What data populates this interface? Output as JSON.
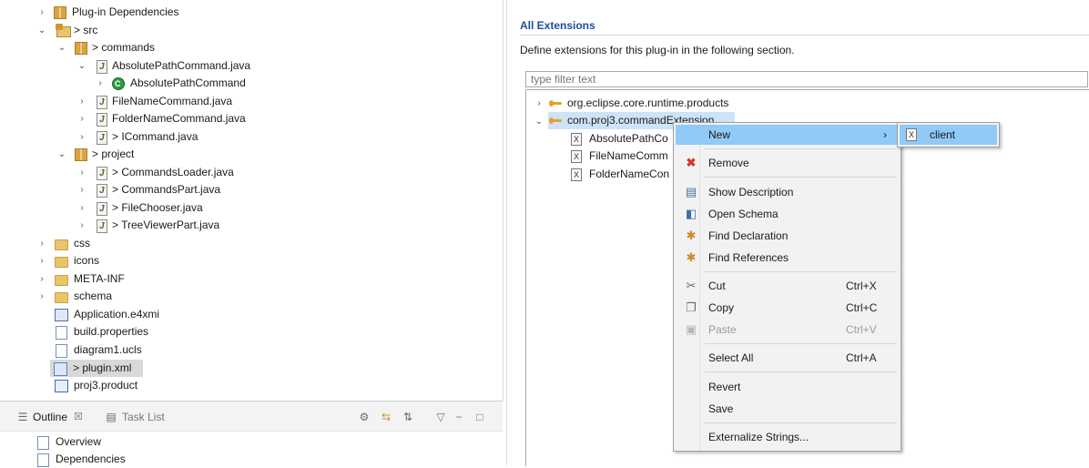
{
  "tree": {
    "items": [
      {
        "label": "Plug-in Dependencies",
        "chev": "›",
        "icon": "pkg"
      },
      {
        "label": "> src",
        "chev": "⌄",
        "icon": "srcf"
      },
      {
        "label": "> commands",
        "chev": "⌄",
        "icon": "pkg"
      },
      {
        "label": "AbsolutePathCommand.java",
        "chev": "⌄",
        "icon": "java"
      },
      {
        "label": "AbsolutePathCommand",
        "chev": "›",
        "icon": "cls"
      },
      {
        "label": "FileNameCommand.java",
        "chev": "›",
        "icon": "java"
      },
      {
        "label": "FolderNameCommand.java",
        "chev": "›",
        "icon": "java"
      },
      {
        "label": "> ICommand.java",
        "chev": "›",
        "icon": "java"
      },
      {
        "label": "> project",
        "chev": "⌄",
        "icon": "pkg"
      },
      {
        "label": "> CommandsLoader.java",
        "chev": "›",
        "icon": "java"
      },
      {
        "label": "> CommandsPart.java",
        "chev": "›",
        "icon": "java"
      },
      {
        "label": "> FileChooser.java",
        "chev": "›",
        "icon": "java"
      },
      {
        "label": "> TreeViewerPart.java",
        "chev": "›",
        "icon": "java"
      },
      {
        "label": "css",
        "chev": "›",
        "icon": "folder"
      },
      {
        "label": "icons",
        "chev": "›",
        "icon": "folder"
      },
      {
        "label": "META-INF",
        "chev": "›",
        "icon": "folder"
      },
      {
        "label": "schema",
        "chev": "›",
        "icon": "folder"
      },
      {
        "label": "Application.e4xmi",
        "chev": "",
        "icon": "grid"
      },
      {
        "label": "build.properties",
        "chev": "",
        "icon": "doc"
      },
      {
        "label": "diagram1.ucls",
        "chev": "",
        "icon": "doc"
      },
      {
        "label": "> plugin.xml",
        "chev": "",
        "icon": "plug"
      },
      {
        "label": "proj3.product",
        "chev": "",
        "icon": "prod"
      }
    ]
  },
  "outline": {
    "tab_outline": "Outline",
    "tab_outline_close": "☒",
    "tab_tasklist": "Task List",
    "items": [
      "Overview",
      "Dependencies"
    ]
  },
  "extensions": {
    "title": "All Extensions",
    "description": "Define extensions for this plug-in in the following section.",
    "filter_placeholder": "type filter text",
    "items": [
      {
        "label": "org.eclipse.core.runtime.products",
        "chev": "›"
      },
      {
        "label": "com.proj3.commandExtension",
        "chev": "⌄"
      },
      {
        "label": "AbsolutePathCo"
      },
      {
        "label": "FileNameComm"
      },
      {
        "label": "FolderNameCon"
      }
    ]
  },
  "context_menu": {
    "new": "New",
    "new_arrow": "›",
    "remove": "Remove",
    "show_description": "Show Description",
    "open_schema": "Open Schema",
    "find_declaration": "Find Declaration",
    "find_references": "Find References",
    "cut": "Cut",
    "cut_shortcut": "Ctrl+X",
    "copy": "Copy",
    "copy_shortcut": "Ctrl+C",
    "paste": "Paste",
    "paste_shortcut": "Ctrl+V",
    "select_all": "Select All",
    "select_all_shortcut": "Ctrl+A",
    "revert": "Revert",
    "save": "Save",
    "externalize": "Externalize Strings..."
  },
  "submenu": {
    "client": "client",
    "x_glyph": "X"
  }
}
